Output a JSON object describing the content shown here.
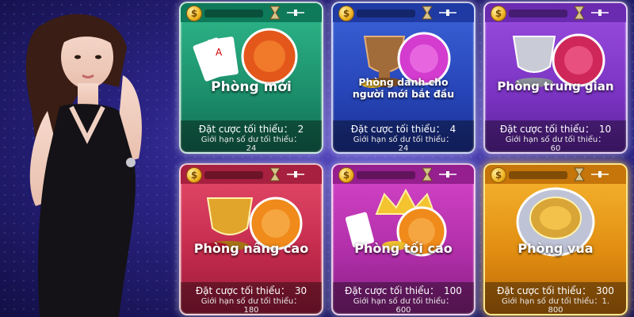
{
  "rooms": [
    {
      "name": "Phòng mới",
      "bet_label": "Đặt cược tối thiểu：",
      "bet_value": "2",
      "limit_label": "Giới hạn số dư tối thiểu：",
      "limit_value": "24",
      "color": "#1c8f6b"
    },
    {
      "name": "Phòng dành cho người mới bắt đầu",
      "bet_label": "Đặt cược tối thiểu：",
      "bet_value": "4",
      "limit_label": "Giới hạn số dư tối thiểu：",
      "limit_value": "24",
      "color": "#2745b8"
    },
    {
      "name": "Phòng trung gian",
      "bet_label": "Đặt cược tối thiểu：",
      "bet_value": "10",
      "limit_label": "Giới hạn số dư tối thiểu：",
      "limit_value": "60",
      "color": "#7b34c3"
    },
    {
      "name": "Phòng nâng cao",
      "bet_label": "Đặt cược tối thiểu：",
      "bet_value": "30",
      "limit_label": "Giới hạn số dư tối thiểu：",
      "limit_value": "180",
      "color": "#c22a4c"
    },
    {
      "name": "Phòng tối cao",
      "bet_label": "Đặt cược tối thiểu：",
      "bet_value": "100",
      "limit_label": "Giới hạn số dư tối thiểu：",
      "limit_value": "600",
      "color": "#b02ea8"
    },
    {
      "name": "Phòng vua",
      "bet_label": "Đặt cược tối thiểu：",
      "bet_value": "300",
      "limit_label": "Giới hạn số dư tối thiểu：1.",
      "limit_value": "800",
      "color": "#e08c10"
    }
  ],
  "icons": {
    "coin": "$",
    "hourglass": "hourglass-icon",
    "slider": "slider-icon"
  }
}
